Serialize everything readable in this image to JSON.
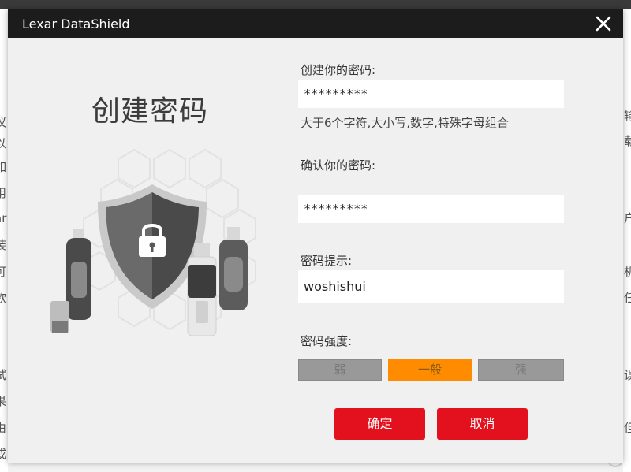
{
  "dialog": {
    "title": "Lexar DataShield",
    "close_glyph": "✕"
  },
  "hero": {
    "title": "创建密码"
  },
  "form": {
    "create_label": "创建你的密码:",
    "create_value": "*********",
    "create_helper": "大于6个字符,大小写,数字,特殊字母组合",
    "confirm_label": "确认你的密码:",
    "confirm_value": "*********",
    "hint_label": "密码提示:",
    "hint_value": "woshishui",
    "strength_label": "密码强度:",
    "strength": {
      "weak": "弱",
      "medium": "一般",
      "strong": "强",
      "selected": "medium"
    }
  },
  "buttons": {
    "confirm": "确定",
    "cancel": "取消"
  },
  "background": {
    "left_glyphs": [
      "议",
      "以",
      "如",
      "用",
      "ar",
      "装",
      "可",
      "欲",
      "试",
      "果",
      "由",
      "或"
    ],
    "right_glyphs": [
      "输",
      "载",
      "户",
      "机",
      "任",
      "误",
      "但"
    ]
  },
  "colors": {
    "accent_red": "#e3101e",
    "strength_active": "#ff8c00",
    "titlebar": "#1c1c1c"
  }
}
